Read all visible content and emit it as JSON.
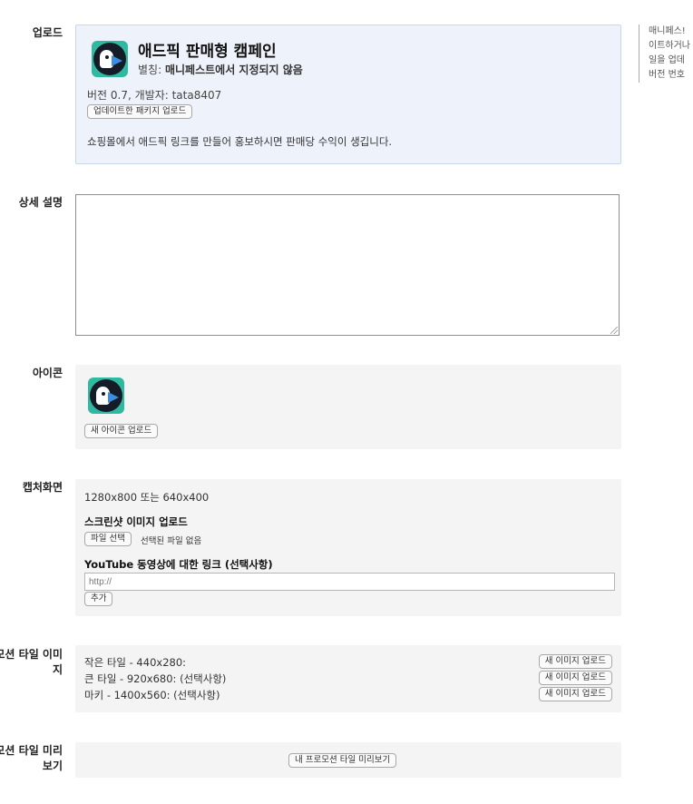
{
  "upload": {
    "label": "업로드",
    "app_title": "애드픽 판매형 캠페인",
    "alias_prefix": "별칭:",
    "alias_value": "매니페스트에서 지정되지 않음",
    "version": "버전 0.7, 개발자: tata8407",
    "update_button": "업데이트한 패키지 업로드",
    "description": "쇼핑몰에서 애드픽 링크를 만들어 홍보하시면 판매당 수익이 생깁니다.",
    "side_note": [
      "매니페스!",
      "이트하거나",
      "일을 업데",
      "버전 번호"
    ]
  },
  "detail": {
    "label": "상세 설명",
    "value": ""
  },
  "icon_section": {
    "label": "아이콘",
    "upload_button": "새 아이콘 업로드"
  },
  "screenshots": {
    "label": "캡처화면",
    "sizes": "1280x800 또는 640x400",
    "upload_heading": "스크린샷 이미지 업로드",
    "file_button": "파일 선택",
    "no_file": "선택된 파일 없음",
    "youtube_heading": "YouTube 동영상에 대한 링크 (선택사항)",
    "youtube_placeholder": "http://",
    "add_button": "추가"
  },
  "promo_tiles": {
    "label_line1": "모션 타일 이미",
    "label_line2": "지",
    "rows": [
      {
        "text": "작은 타일 - 440x280:",
        "button": "새 이미지 업로드"
      },
      {
        "text": "큰 타일 - 920x680: (선택사항)",
        "button": "새 이미지 업로드"
      },
      {
        "text": "마키 - 1400x560: (선택사항)",
        "button": "새 이미지 업로드"
      }
    ]
  },
  "promo_preview": {
    "label_line1": "모션 타일 미리",
    "label_line2": "보기",
    "button": "내 프로모션 타일 미리보기"
  },
  "colors": {
    "upload_bg": "#eef3fb",
    "panel_bg": "#f4f4f4",
    "icon_accent": "#2fb9a0"
  },
  "icons": {
    "app_icon": "penguin-logo-icon"
  }
}
